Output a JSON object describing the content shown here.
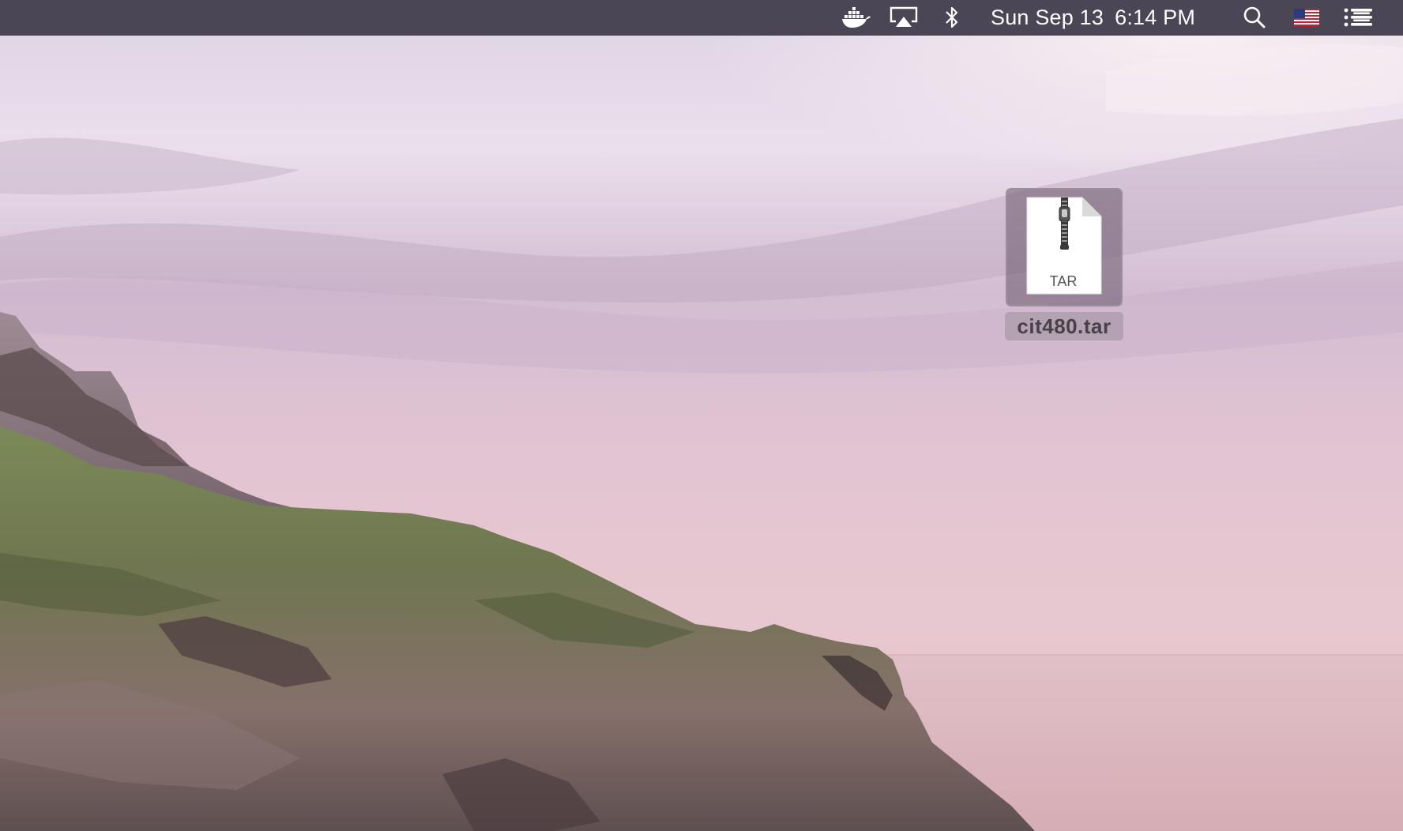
{
  "menubar": {
    "clock": {
      "date": "Sun Sep 13",
      "time": "6:14 PM"
    },
    "status_icons": [
      "docker-icon",
      "airplay-icon",
      "bluetooth-icon"
    ],
    "right_icons": [
      "spotlight-search-icon",
      "us-flag-input-icon",
      "notification-center-icon"
    ]
  },
  "desktop": {
    "files": [
      {
        "name": "cit480.tar",
        "type_label": "TAR",
        "icon": "archive-file-icon",
        "selected": true
      }
    ]
  },
  "colors": {
    "menubar_bg": "#4a4655",
    "selection_bg": "#7a667a",
    "sky_top": "#d9d0e2",
    "sky_mid": "#d8c0d4",
    "sea": "#dcb7bd"
  }
}
